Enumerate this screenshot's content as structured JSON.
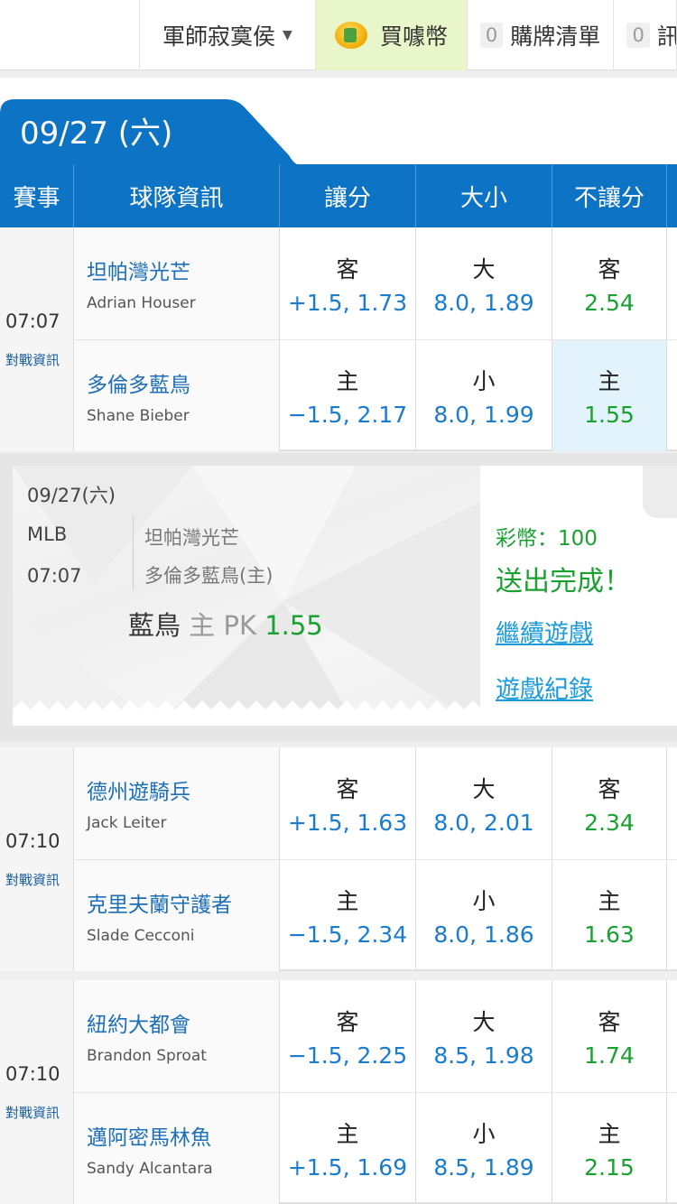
{
  "topbar": {
    "user_label": "軍師寂寞侯",
    "buy_label": "買噱幣",
    "cart_count": "0",
    "cart_label": "購牌清單",
    "msg_count": "0",
    "msg_label": "訊"
  },
  "date_label": "09/27 (六)",
  "header": [
    "賽事",
    "球隊資訊",
    "讓分",
    "大小",
    "不讓分"
  ],
  "games": [
    {
      "time": "07:07",
      "info": "對戰資訊",
      "away": {
        "cn": "坦帕灣光芒",
        "en": "Adrian Houser",
        "spread_label": "客",
        "spread": "+1.5, 1.73",
        "total_label": "大",
        "total": "8.0, 1.89",
        "ml_label": "客",
        "ml": "2.54"
      },
      "home": {
        "cn": "多倫多藍鳥",
        "en": "Shane Bieber",
        "spread_label": "主",
        "spread": "−1.5, 2.17",
        "total_label": "小",
        "total": "8.0, 1.99",
        "ml_label": "主",
        "ml": "1.55"
      }
    },
    {
      "time": "07:10",
      "info": "對戰資訊",
      "away": {
        "cn": "德州遊騎兵",
        "en": "Jack Leiter",
        "spread_label": "客",
        "spread": "+1.5, 1.63",
        "total_label": "大",
        "total": "8.0, 2.01",
        "ml_label": "客",
        "ml": "2.34"
      },
      "home": {
        "cn": "克里夫蘭守護者",
        "en": "Slade Cecconi",
        "spread_label": "主",
        "spread": "−1.5, 2.34",
        "total_label": "小",
        "total": "8.0, 1.86",
        "ml_label": "主",
        "ml": "1.63"
      }
    },
    {
      "time": "07:10",
      "info": "對戰資訊",
      "away": {
        "cn": "紐約大都會",
        "en": "Brandon Sproat",
        "spread_label": "客",
        "spread": "−1.5, 2.25",
        "total_label": "大",
        "total": "8.5, 1.98",
        "ml_label": "客",
        "ml": "1.74"
      },
      "home": {
        "cn": "邁阿密馬林魚",
        "en": "Sandy Alcantara",
        "spread_label": "主",
        "spread": "+1.5, 1.69",
        "total_label": "小",
        "total": "8.5, 1.89",
        "ml_label": "主",
        "ml": "2.15"
      }
    }
  ],
  "popup": {
    "date": "09/27(六)",
    "league": "MLB",
    "time": "07:07",
    "away": "坦帕灣光芒",
    "home": "多倫多藍鳥(主)",
    "bet_team": "藍鳥",
    "bet_side": "主 PK",
    "bet_odds": "1.55",
    "balance": "彩幣：100",
    "done": "送出完成！",
    "continue": "繼續遊戲",
    "history": "遊戲紀錄"
  },
  "colors": {
    "header_blue": "#0d73c4",
    "link_blue": "#1a7ccf",
    "odds_green": "#1aa230",
    "buy_bg": "#e8f6c9"
  }
}
